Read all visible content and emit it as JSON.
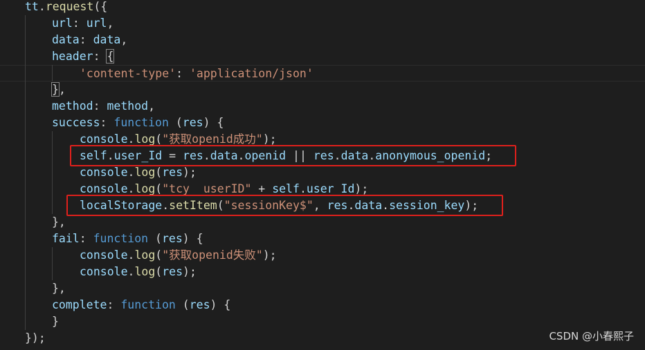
{
  "editor": {
    "lines": [
      {
        "indent": 0,
        "tokens": [
          [
            "var",
            "tt"
          ],
          [
            "punc",
            "."
          ],
          [
            "fn",
            "request"
          ],
          [
            "punc",
            "({"
          ]
        ]
      },
      {
        "indent": 1,
        "tokens": [
          [
            "var",
            "url"
          ],
          [
            "punc",
            ": "
          ],
          [
            "var",
            "url"
          ],
          [
            "punc",
            ","
          ]
        ]
      },
      {
        "indent": 1,
        "tokens": [
          [
            "var",
            "data"
          ],
          [
            "punc",
            ": "
          ],
          [
            "var",
            "data"
          ],
          [
            "punc",
            ","
          ]
        ]
      },
      {
        "indent": 1,
        "tokens": [
          [
            "var",
            "header"
          ],
          [
            "punc",
            ": "
          ],
          [
            "brkt",
            "{"
          ]
        ]
      },
      {
        "indent": 2,
        "tokens": [
          [
            "str",
            "'content-type'"
          ],
          [
            "punc",
            ": "
          ],
          [
            "str",
            "'application/json'"
          ]
        ],
        "current": true
      },
      {
        "indent": 1,
        "tokens": [
          [
            "brkt",
            "}"
          ],
          [
            "punc",
            ","
          ]
        ]
      },
      {
        "indent": 1,
        "tokens": [
          [
            "var",
            "method"
          ],
          [
            "punc",
            ": "
          ],
          [
            "var",
            "method"
          ],
          [
            "punc",
            ","
          ]
        ]
      },
      {
        "indent": 1,
        "tokens": [
          [
            "var",
            "success"
          ],
          [
            "punc",
            ": "
          ],
          [
            "kw",
            "function"
          ],
          [
            "punc",
            " ("
          ],
          [
            "var",
            "res"
          ],
          [
            "punc",
            ") {"
          ]
        ]
      },
      {
        "indent": 2,
        "tokens": [
          [
            "var",
            "console"
          ],
          [
            "punc",
            "."
          ],
          [
            "fn",
            "log"
          ],
          [
            "punc",
            "("
          ],
          [
            "str",
            "\"获取openid成功\""
          ],
          [
            "punc",
            ");"
          ]
        ]
      },
      {
        "indent": 2,
        "tokens": [
          [
            "var",
            "self"
          ],
          [
            "punc",
            "."
          ],
          [
            "var",
            "user_Id"
          ],
          [
            "punc",
            " = "
          ],
          [
            "var",
            "res"
          ],
          [
            "punc",
            "."
          ],
          [
            "var",
            "data"
          ],
          [
            "punc",
            "."
          ],
          [
            "var",
            "openid"
          ],
          [
            "punc",
            " || "
          ],
          [
            "var",
            "res"
          ],
          [
            "punc",
            "."
          ],
          [
            "var",
            "data"
          ],
          [
            "punc",
            "."
          ],
          [
            "var",
            "anonymous_openid"
          ],
          [
            "punc",
            ";"
          ]
        ]
      },
      {
        "indent": 2,
        "tokens": [
          [
            "var",
            "console"
          ],
          [
            "punc",
            "."
          ],
          [
            "fn",
            "log"
          ],
          [
            "punc",
            "("
          ],
          [
            "var",
            "res"
          ],
          [
            "punc",
            ");"
          ]
        ]
      },
      {
        "indent": 2,
        "tokens": [
          [
            "var",
            "console"
          ],
          [
            "punc",
            "."
          ],
          [
            "fn",
            "log"
          ],
          [
            "punc",
            "("
          ],
          [
            "str",
            "\"tcy  userID\""
          ],
          [
            "punc",
            " + "
          ],
          [
            "var",
            "self"
          ],
          [
            "punc",
            "."
          ],
          [
            "var",
            "user_Id"
          ],
          [
            "punc",
            ");"
          ]
        ]
      },
      {
        "indent": 2,
        "tokens": [
          [
            "var",
            "localStorage"
          ],
          [
            "punc",
            "."
          ],
          [
            "fn",
            "setItem"
          ],
          [
            "punc",
            "("
          ],
          [
            "str",
            "\"sessionKey$\""
          ],
          [
            "punc",
            ", "
          ],
          [
            "var",
            "res"
          ],
          [
            "punc",
            "."
          ],
          [
            "var",
            "data"
          ],
          [
            "punc",
            "."
          ],
          [
            "var",
            "session_key"
          ],
          [
            "punc",
            ");"
          ]
        ]
      },
      {
        "indent": 1,
        "tokens": [
          [
            "punc",
            "},"
          ]
        ]
      },
      {
        "indent": 1,
        "tokens": [
          [
            "var",
            "fail"
          ],
          [
            "punc",
            ": "
          ],
          [
            "kw",
            "function"
          ],
          [
            "punc",
            " ("
          ],
          [
            "var",
            "res"
          ],
          [
            "punc",
            ") {"
          ]
        ]
      },
      {
        "indent": 2,
        "tokens": [
          [
            "var",
            "console"
          ],
          [
            "punc",
            "."
          ],
          [
            "fn",
            "log"
          ],
          [
            "punc",
            "("
          ],
          [
            "str",
            "\"获取openid失败\""
          ],
          [
            "punc",
            ");"
          ]
        ]
      },
      {
        "indent": 2,
        "tokens": [
          [
            "var",
            "console"
          ],
          [
            "punc",
            "."
          ],
          [
            "fn",
            "log"
          ],
          [
            "punc",
            "("
          ],
          [
            "var",
            "res"
          ],
          [
            "punc",
            ");"
          ]
        ]
      },
      {
        "indent": 1,
        "tokens": [
          [
            "punc",
            "},"
          ]
        ]
      },
      {
        "indent": 1,
        "tokens": [
          [
            "var",
            "complete"
          ],
          [
            "punc",
            ": "
          ],
          [
            "kw",
            "function"
          ],
          [
            "punc",
            " ("
          ],
          [
            "var",
            "res"
          ],
          [
            "punc",
            ") {"
          ]
        ]
      },
      {
        "indent": 1,
        "tokens": [
          [
            "punc",
            "}"
          ]
        ]
      },
      {
        "indent": 0,
        "tokens": [
          [
            "punc",
            "});"
          ]
        ]
      }
    ],
    "highlighted_lines": [
      9,
      12
    ]
  },
  "colors": {
    "background": "#1e1e1e",
    "variable": "#9cdcfe",
    "function": "#dcdcaa",
    "keyword": "#569cd6",
    "string": "#ce9178",
    "punctuation": "#d4d4d4",
    "highlight_box": "#e0201c"
  },
  "watermark": {
    "text": "CSDN @小春熙子"
  }
}
